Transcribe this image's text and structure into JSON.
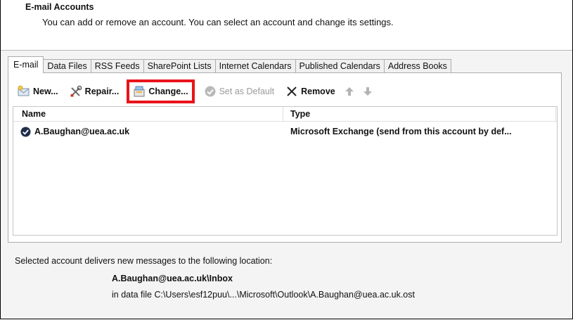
{
  "header": {
    "title": "E-mail Accounts",
    "description": "You can add or remove an account. You can select an account and change its settings."
  },
  "tabs": [
    {
      "label": "E-mail",
      "active": true
    },
    {
      "label": "Data Files"
    },
    {
      "label": "RSS Feeds"
    },
    {
      "label": "SharePoint Lists"
    },
    {
      "label": "Internet Calendars"
    },
    {
      "label": "Published Calendars"
    },
    {
      "label": "Address Books"
    }
  ],
  "toolbar": {
    "new_label": "New...",
    "repair_label": "Repair...",
    "change_label": "Change...",
    "set_default_label": "Set as Default",
    "remove_label": "Remove",
    "highlight_color": "#e8141b"
  },
  "list": {
    "columns": [
      "Name",
      "Type"
    ],
    "rows": [
      {
        "name": "A.Baughan@uea.ac.uk",
        "type": "Microsoft Exchange (send from this account by def...",
        "default": true
      }
    ]
  },
  "location": {
    "label": "Selected account delivers new messages to the following location:",
    "path": "A.Baughan@uea.ac.uk\\Inbox",
    "file": "in data file C:\\Users\\esf12puu\\...\\Microsoft\\Outlook\\A.Baughan@uea.ac.uk.ost"
  }
}
